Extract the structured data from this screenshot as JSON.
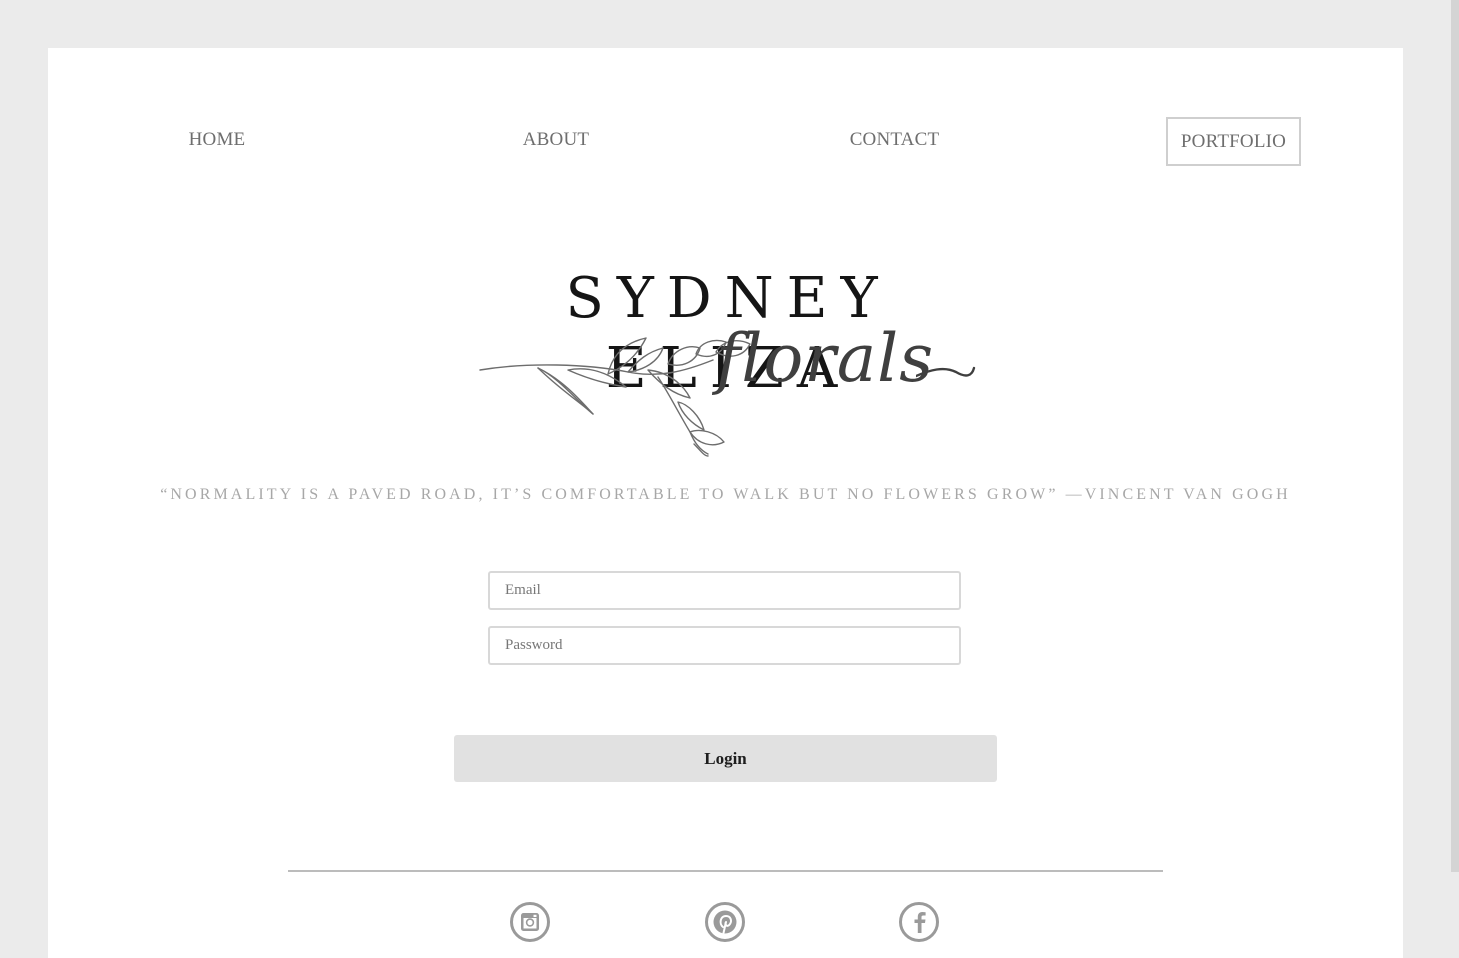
{
  "nav": {
    "home": "HOME",
    "about": "ABOUT",
    "contact": "CONTACT",
    "portfolio": "PORTFOLIO"
  },
  "logo": {
    "title": "SYDNEY ELIZA",
    "script": "florals"
  },
  "quote": "“NORMALITY IS A PAVED ROAD, IT’S COMFORTABLE TO WALK BUT NO FLOWERS GROW” —VINCENT VAN GOGH",
  "form": {
    "email_placeholder": "Email",
    "email_value": "",
    "password_placeholder": "Password",
    "password_value": "",
    "login_label": "Login"
  },
  "social": [
    {
      "icon": "instagram-icon"
    },
    {
      "icon": "pinterest-icon"
    },
    {
      "icon": "facebook-icon"
    }
  ],
  "colors": {
    "background": "#ebebeb",
    "page": "#ffffff",
    "nav_text": "#6e6e6e",
    "quote_text": "#a7a7a7",
    "icon": "#9a9a9a",
    "button": "#e1e1e1"
  }
}
